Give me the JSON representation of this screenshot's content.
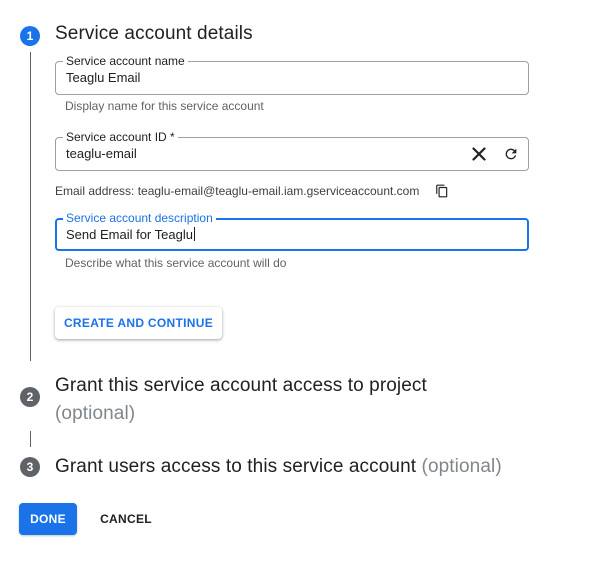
{
  "steps": [
    {
      "number": "1",
      "title": "Service account details",
      "optional": ""
    },
    {
      "number": "2",
      "title": "Grant this service account access to project",
      "optional": "(optional)"
    },
    {
      "number": "3",
      "title": "Grant users access to this service account",
      "optional": "(optional)"
    }
  ],
  "form": {
    "name": {
      "label": "Service account name",
      "value": "Teaglu Email",
      "hint": "Display name for this service account"
    },
    "id": {
      "label": "Service account ID *",
      "value": "teaglu-email",
      "clear_icon": "close-icon",
      "refresh_icon": "refresh-icon"
    },
    "email": {
      "prefix": "Email address: ",
      "address": "teaglu-email@teaglu-email.iam.gserviceaccount.com",
      "copy_icon": "copy-icon"
    },
    "description": {
      "label": "Service account description",
      "value": "Send Email for Teaglu",
      "hint": "Describe what this service account will do"
    }
  },
  "buttons": {
    "create_continue": "CREATE AND CONTINUE",
    "done": "DONE",
    "cancel": "CANCEL"
  },
  "colors": {
    "accent": "#1a73e8",
    "inactive_step": "#5f6368"
  }
}
